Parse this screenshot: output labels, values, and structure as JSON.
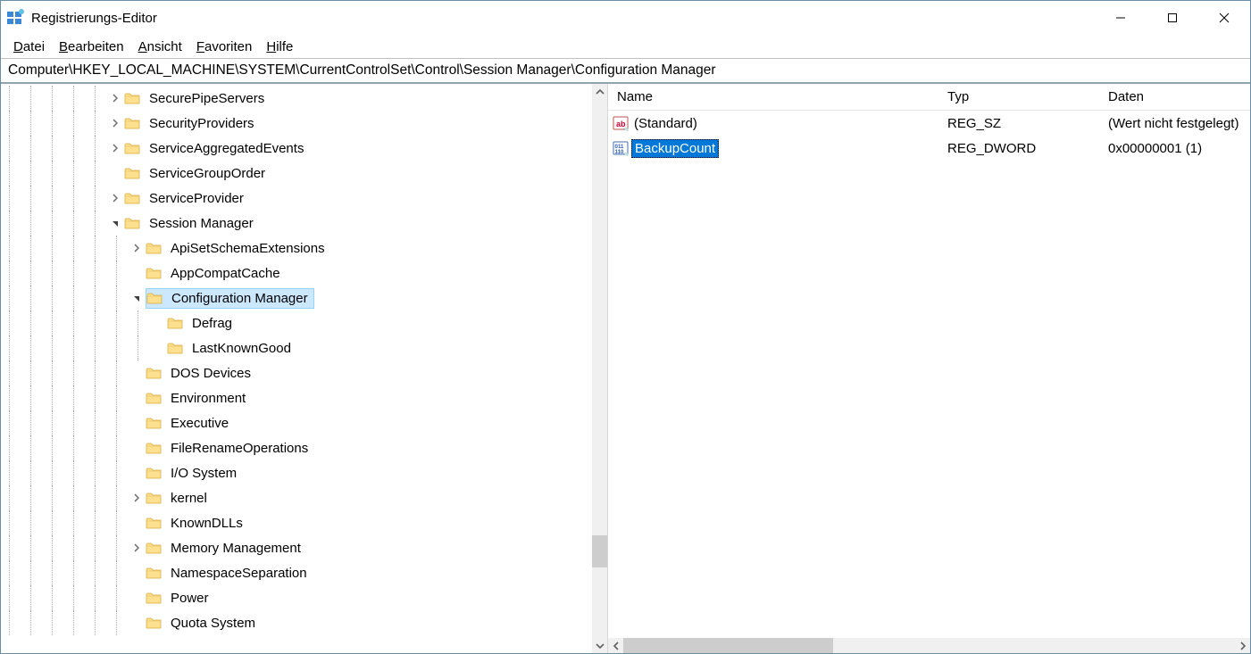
{
  "window": {
    "title": "Registrierungs-Editor"
  },
  "menu": {
    "datei": "Datei",
    "bearbeiten": "Bearbeiten",
    "ansicht": "Ansicht",
    "favoriten": "Favoriten",
    "hilfe": "Hilfe"
  },
  "address": "Computer\\HKEY_LOCAL_MACHINE\\SYSTEM\\CurrentControlSet\\Control\\Session Manager\\Configuration Manager",
  "tree": {
    "items": [
      {
        "depth": 5,
        "expander": "closed",
        "label": "SecurePipeServers"
      },
      {
        "depth": 5,
        "expander": "closed",
        "label": "SecurityProviders"
      },
      {
        "depth": 5,
        "expander": "closed",
        "label": "ServiceAggregatedEvents"
      },
      {
        "depth": 5,
        "expander": "none",
        "label": "ServiceGroupOrder"
      },
      {
        "depth": 5,
        "expander": "closed",
        "label": "ServiceProvider"
      },
      {
        "depth": 5,
        "expander": "open",
        "label": "Session Manager"
      },
      {
        "depth": 6,
        "expander": "closed",
        "label": "ApiSetSchemaExtensions"
      },
      {
        "depth": 6,
        "expander": "none",
        "label": "AppCompatCache"
      },
      {
        "depth": 6,
        "expander": "open",
        "label": "Configuration Manager",
        "selected": true
      },
      {
        "depth": 7,
        "expander": "none",
        "label": "Defrag"
      },
      {
        "depth": 7,
        "expander": "none",
        "label": "LastKnownGood"
      },
      {
        "depth": 6,
        "expander": "none",
        "label": "DOS Devices"
      },
      {
        "depth": 6,
        "expander": "none",
        "label": "Environment"
      },
      {
        "depth": 6,
        "expander": "none",
        "label": "Executive"
      },
      {
        "depth": 6,
        "expander": "none",
        "label": "FileRenameOperations"
      },
      {
        "depth": 6,
        "expander": "none",
        "label": "I/O System"
      },
      {
        "depth": 6,
        "expander": "closed",
        "label": "kernel"
      },
      {
        "depth": 6,
        "expander": "none",
        "label": "KnownDLLs"
      },
      {
        "depth": 6,
        "expander": "closed",
        "label": "Memory Management"
      },
      {
        "depth": 6,
        "expander": "none",
        "label": "NamespaceSeparation"
      },
      {
        "depth": 6,
        "expander": "none",
        "label": "Power"
      },
      {
        "depth": 6,
        "expander": "none",
        "label": "Quota System"
      }
    ]
  },
  "list": {
    "columns": {
      "name": "Name",
      "type": "Typ",
      "data": "Daten"
    },
    "rows": [
      {
        "icon": "string",
        "name": "(Standard)",
        "type": "REG_SZ",
        "data": "(Wert nicht festgelegt)",
        "selected": false
      },
      {
        "icon": "dword",
        "name": "BackupCount",
        "type": "REG_DWORD",
        "data": "0x00000001 (1)",
        "selected": true
      }
    ]
  }
}
